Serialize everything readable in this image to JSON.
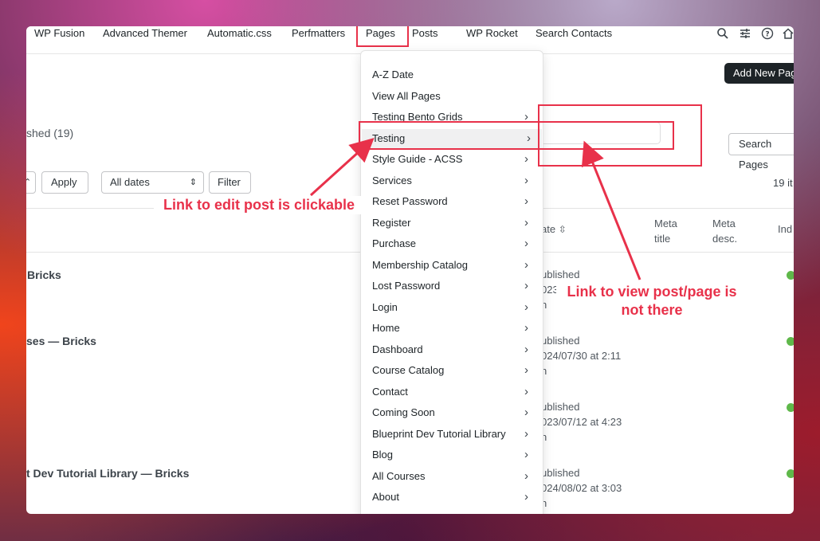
{
  "topnav": {
    "items": [
      "WP Fusion",
      "Advanced Themer",
      "Automatic.css",
      "Perfmatters",
      "Pages",
      "Posts",
      "WP Rocket",
      "Search Contacts"
    ]
  },
  "toolbar_icons": [
    "search-icon",
    "sliders-icon",
    "help-icon",
    "home-icon"
  ],
  "page": {
    "add_new_label": "Add New Page",
    "published_filter": "shed (19)",
    "search_button": "Search Pages",
    "apply_button": "Apply",
    "dates_select": "All dates",
    "filter_button": "Filter",
    "items_count": "19 it",
    "columns": {
      "date": "ate",
      "meta_title": [
        "Meta",
        "title"
      ],
      "meta_desc": [
        "Meta",
        "desc."
      ],
      "index": "Ind"
    },
    "rows": [
      {
        "title": "Bricks",
        "status": "ublished",
        "date": "023",
        "author": "n"
      },
      {
        "title_prefix": "ses — ",
        "title": "Bricks",
        "status": "ublished",
        "date": "024/07/30 at 2:11",
        "author": "n"
      },
      {
        "title": "",
        "status": "ublished",
        "date": "023/07/12 at 4:23",
        "author": "n"
      },
      {
        "title_prefix": "t Dev Tutorial Library — ",
        "title": "Bricks",
        "status": "ublished",
        "date": "024/08/02 at 3:03",
        "author": "n"
      }
    ]
  },
  "pages_menu": {
    "items": [
      {
        "label": "A-Z Date",
        "submenu": false
      },
      {
        "label": "View All Pages",
        "submenu": false
      },
      {
        "label": "Testing Bento Grids",
        "submenu": true
      },
      {
        "label": "Testing",
        "submenu": true,
        "active": true
      },
      {
        "label": "Style Guide - ACSS",
        "submenu": true
      },
      {
        "label": "Services",
        "submenu": true
      },
      {
        "label": "Reset Password",
        "submenu": true
      },
      {
        "label": "Register",
        "submenu": true
      },
      {
        "label": "Purchase",
        "submenu": true
      },
      {
        "label": "Membership Catalog",
        "submenu": true
      },
      {
        "label": "Lost Password",
        "submenu": true
      },
      {
        "label": "Login",
        "submenu": true
      },
      {
        "label": "Home",
        "submenu": true
      },
      {
        "label": "Dashboard",
        "submenu": true
      },
      {
        "label": "Course Catalog",
        "submenu": true
      },
      {
        "label": "Contact",
        "submenu": true
      },
      {
        "label": "Coming Soon",
        "submenu": true
      },
      {
        "label": "Blueprint Dev Tutorial Library",
        "submenu": true
      },
      {
        "label": "Blog",
        "submenu": true
      },
      {
        "label": "All Courses",
        "submenu": true
      },
      {
        "label": "About",
        "submenu": true
      }
    ]
  },
  "annotations": {
    "left": "Link to edit post is clickable",
    "right_line1": "Link to view post/page is",
    "right_line2": "not there",
    "color": "#e8314a"
  }
}
